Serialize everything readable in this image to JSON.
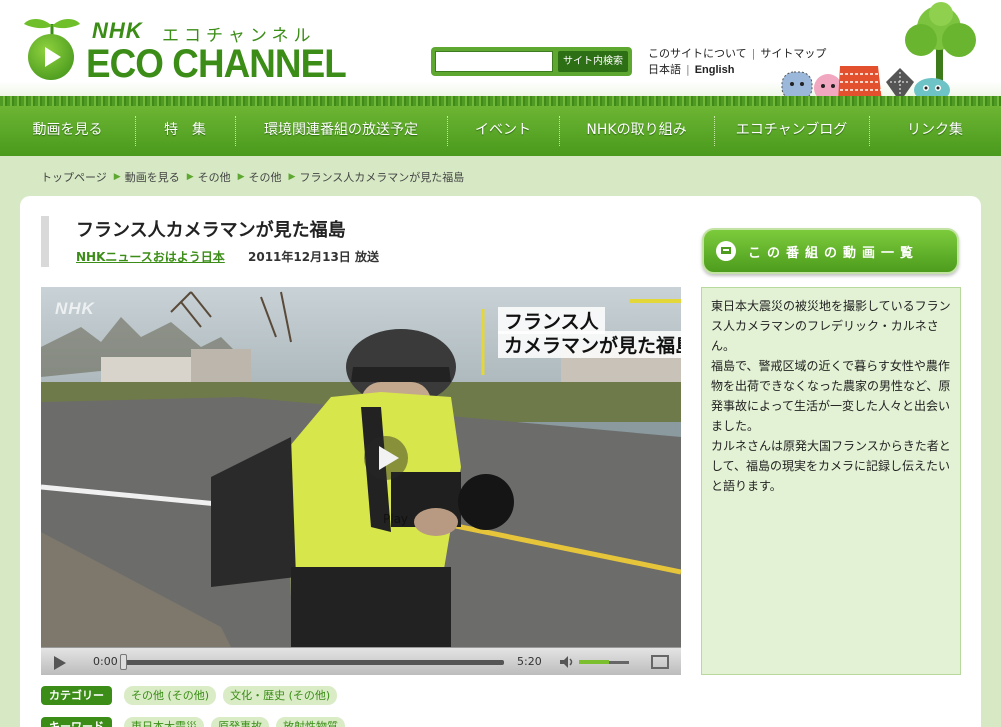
{
  "header": {
    "logo": {
      "nhk": "NHK",
      "kana": "エコチャンネル",
      "title": "ECO CHANNEL"
    },
    "search": {
      "placeholder": "",
      "button_label": "サイト内検索"
    },
    "links": {
      "about": "このサイトについて",
      "sitemap": "サイトマップ",
      "japanese": "日本語",
      "english": "English"
    }
  },
  "nav": {
    "items": [
      {
        "label": "動画を見る"
      },
      {
        "label": "特　集"
      },
      {
        "label": "環境関連番組の放送予定"
      },
      {
        "label": "イベント"
      },
      {
        "label": "NHKの取り組み"
      },
      {
        "label": "エコチャンブログ"
      },
      {
        "label": "リンク集"
      }
    ]
  },
  "breadcrumb": [
    "トップページ",
    "動画を見る",
    "その他",
    "その他",
    "フランス人カメラマンが見た福島"
  ],
  "page": {
    "title": "フランス人カメラマンが見た福島",
    "program_link": "NHKニュースおはよう日本",
    "airdate": "2011年12月13日 放送",
    "list_button": "この番組の動画一覧"
  },
  "video": {
    "watermark": "NHK",
    "caption_line1": "フランス人",
    "caption_line2": "カメラマンが見た福島",
    "play_label": "Play",
    "time_current": "0:00",
    "time_duration": "5:20",
    "progress": 0.0,
    "volume": 0.6
  },
  "description": {
    "paragraphs": [
      "東日本大震災の被災地を撮影しているフランス人カメラマンのフレデリック・カルネさん。",
      "福島で、警戒区域の近くで暮らす女性や農作物を出荷できなくなった農家の男性など、原発事故によって生活が一変した人々と出会いました。",
      "カルネさんは原発大国フランスからきた者として、福島の現実をカメラに記録し伝えたいと語ります。"
    ]
  },
  "categories": {
    "label": "カテゴリー",
    "tags": [
      "その他 (その他)",
      "文化・歴史 (その他)"
    ]
  },
  "keywords": {
    "label": "キーワード",
    "tags": [
      "東日本大震災",
      "原発事故",
      "放射性物質"
    ]
  },
  "colors": {
    "brand_green": "#3b8d17",
    "nav_green": "#5ea831",
    "background": "#d6e9c4"
  }
}
